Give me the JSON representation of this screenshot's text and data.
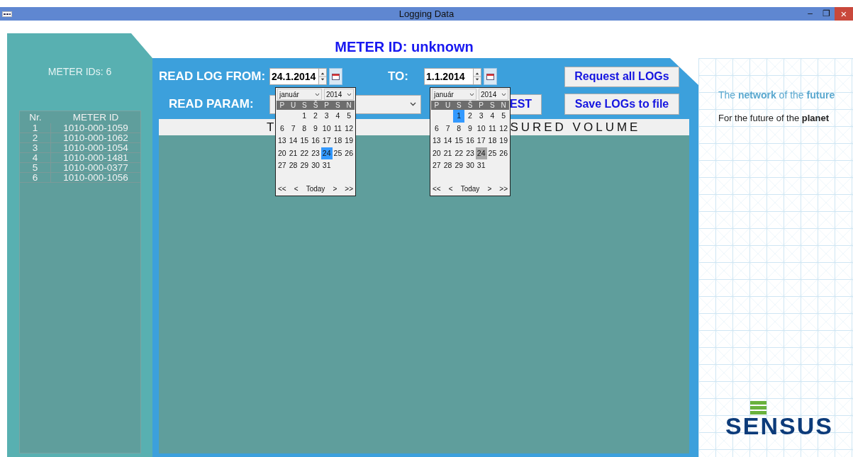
{
  "window": {
    "title": "Logging Data",
    "controls": [
      {
        "kind": "minimize",
        "glyph": "–"
      },
      {
        "kind": "restore",
        "glyph": "❐"
      },
      {
        "kind": "close",
        "glyph": "×"
      }
    ]
  },
  "meter_list": {
    "count_label": "METER IDs: 6",
    "columns": [
      "Nr.",
      "METER ID"
    ],
    "rows": [
      [
        "1",
        "1010-000-1059"
      ],
      [
        "2",
        "1010-000-1062"
      ],
      [
        "3",
        "1010-000-1054"
      ],
      [
        "4",
        "1010-000-1481"
      ],
      [
        "5",
        "1010-000-0377"
      ],
      [
        "6",
        "1010-000-1056"
      ]
    ]
  },
  "meter_title": "METER ID: unknown",
  "read_log": {
    "from_label": "READ LOG FROM:",
    "to_label": "TO:",
    "pickers": [
      {
        "value": "24.1.2014",
        "calendar": {
          "month": "január",
          "year": "2014",
          "weekdays": [
            "P",
            "U",
            "S",
            "Š",
            "P",
            "S",
            "N"
          ],
          "nav": [
            "<<",
            "<",
            "Today",
            ">",
            ">>"
          ],
          "weeks": [
            [
              {
                "kind": "blank"
              },
              {
                "kind": "blank"
              },
              {
                "kind": "day",
                "d": "1",
                "selected": false
              },
              {
                "kind": "day",
                "d": "2",
                "selected": false
              },
              {
                "kind": "day",
                "d": "3",
                "selected": false
              },
              {
                "kind": "day",
                "d": "4",
                "selected": false
              },
              {
                "kind": "day",
                "d": "5",
                "selected": false
              }
            ],
            [
              {
                "kind": "day",
                "d": "6",
                "selected": false
              },
              {
                "kind": "day",
                "d": "7",
                "selected": false
              },
              {
                "kind": "day",
                "d": "8",
                "selected": false
              },
              {
                "kind": "day",
                "d": "9",
                "selected": false
              },
              {
                "kind": "day",
                "d": "10",
                "selected": false
              },
              {
                "kind": "day",
                "d": "11",
                "selected": false
              },
              {
                "kind": "day",
                "d": "12",
                "selected": false
              }
            ],
            [
              {
                "kind": "day",
                "d": "13",
                "selected": false
              },
              {
                "kind": "day",
                "d": "14",
                "selected": false
              },
              {
                "kind": "day",
                "d": "15",
                "selected": false
              },
              {
                "kind": "day",
                "d": "16",
                "selected": false
              },
              {
                "kind": "day",
                "d": "17",
                "selected": false
              },
              {
                "kind": "day",
                "d": "18",
                "selected": false
              },
              {
                "kind": "day",
                "d": "19",
                "selected": false
              }
            ],
            [
              {
                "kind": "day",
                "d": "20",
                "selected": false
              },
              {
                "kind": "day",
                "d": "21",
                "selected": false
              },
              {
                "kind": "day",
                "d": "22",
                "selected": false
              },
              {
                "kind": "day",
                "d": "23",
                "selected": false
              },
              {
                "kind": "day",
                "d": "24",
                "selected": true
              },
              {
                "kind": "day",
                "d": "25",
                "selected": false
              },
              {
                "kind": "day",
                "d": "26",
                "selected": false
              }
            ],
            [
              {
                "kind": "day",
                "d": "27",
                "selected": false
              },
              {
                "kind": "day",
                "d": "28",
                "selected": false
              },
              {
                "kind": "day",
                "d": "29",
                "selected": false
              },
              {
                "kind": "day",
                "d": "30",
                "selected": false
              },
              {
                "kind": "day",
                "d": "31",
                "selected": false
              },
              {
                "kind": "blank"
              },
              {
                "kind": "blank"
              }
            ]
          ]
        }
      },
      {
        "value": "1.1.2014",
        "calendar": {
          "month": "január",
          "year": "2014",
          "weekdays": [
            "P",
            "U",
            "S",
            "Š",
            "P",
            "S",
            "N"
          ],
          "nav": [
            "<<",
            "<",
            "Today",
            ">",
            ">>"
          ],
          "weeks": [
            [
              {
                "kind": "blank"
              },
              {
                "kind": "blank"
              },
              {
                "kind": "day",
                "d": "1",
                "selected": true
              },
              {
                "kind": "day",
                "d": "2",
                "selected": false,
                "today": false
              },
              {
                "kind": "day",
                "d": "3",
                "selected": false,
                "today": false
              },
              {
                "kind": "day",
                "d": "4",
                "selected": false,
                "today": false
              },
              {
                "kind": "day",
                "d": "5",
                "selected": false,
                "today": false
              }
            ],
            [
              {
                "kind": "day",
                "d": "6",
                "selected": false,
                "today": false
              },
              {
                "kind": "day",
                "d": "7",
                "selected": false,
                "today": false
              },
              {
                "kind": "day",
                "d": "8",
                "selected": false,
                "today": false
              },
              {
                "kind": "day",
                "d": "9",
                "selected": false,
                "today": false
              },
              {
                "kind": "day",
                "d": "10",
                "selected": false,
                "today": false
              },
              {
                "kind": "day",
                "d": "11",
                "selected": false,
                "today": false
              },
              {
                "kind": "day",
                "d": "12",
                "selected": false,
                "today": false
              }
            ],
            [
              {
                "kind": "day",
                "d": "13",
                "selected": false,
                "today": false
              },
              {
                "kind": "day",
                "d": "14",
                "selected": false,
                "today": false
              },
              {
                "kind": "day",
                "d": "15",
                "selected": false,
                "today": false
              },
              {
                "kind": "day",
                "d": "16",
                "selected": false,
                "today": false
              },
              {
                "kind": "day",
                "d": "17",
                "selected": false,
                "today": false
              },
              {
                "kind": "day",
                "d": "18",
                "selected": false,
                "today": false
              },
              {
                "kind": "day",
                "d": "19",
                "selected": false,
                "today": false
              }
            ],
            [
              {
                "kind": "day",
                "d": "20",
                "selected": false,
                "today": false
              },
              {
                "kind": "day",
                "d": "21",
                "selected": false,
                "today": false
              },
              {
                "kind": "day",
                "d": "22",
                "selected": false,
                "today": false
              },
              {
                "kind": "day",
                "d": "23",
                "selected": false,
                "today": false
              },
              {
                "kind": "day",
                "d": "24",
                "selected": false,
                "today": true
              },
              {
                "kind": "day",
                "d": "25",
                "selected": false,
                "today": false
              },
              {
                "kind": "day",
                "d": "26",
                "selected": false,
                "today": false
              }
            ],
            [
              {
                "kind": "day",
                "d": "27",
                "selected": false,
                "today": false
              },
              {
                "kind": "day",
                "d": "28",
                "selected": false,
                "today": false
              },
              {
                "kind": "day",
                "d": "29",
                "selected": false,
                "today": false
              },
              {
                "kind": "day",
                "d": "30",
                "selected": false,
                "today": false
              },
              {
                "kind": "day",
                "d": "31",
                "selected": false,
                "today": false
              },
              {
                "kind": "blank"
              },
              {
                "kind": "blank"
              }
            ]
          ]
        }
      }
    ]
  },
  "read_param": {
    "label": "READ PARAM:"
  },
  "buttons": {
    "request_all": "Request all LOGs",
    "request": "EST",
    "save": "Save LOGs to file"
  },
  "log_table": {
    "header": [
      "T",
      "SURED VOLUME"
    ]
  },
  "tagline": [
    "The **network** of the **future**",
    "For the future of the **planet**"
  ],
  "logo": "SENSUS"
}
